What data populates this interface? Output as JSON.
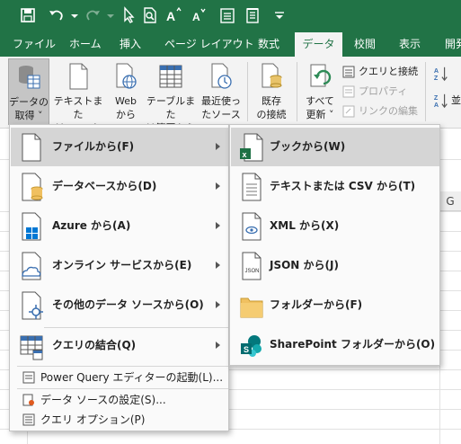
{
  "ribbon_tabs": {
    "file": "ファイル",
    "home": "ホーム",
    "insert": "挿入",
    "page_layout": "ページ レイアウト",
    "formulas": "数式",
    "data": "データ",
    "review": "校閲",
    "view": "表示",
    "developer": "開発"
  },
  "ribbon": {
    "get_data": "データの\n取得 ˅",
    "from_text_csv": "テキストまた\nは CSV から",
    "from_web": "Web\nから",
    "from_table_range": "テーブルまた\nは範囲から",
    "recent_sources": "最近使っ\nたソース",
    "existing_connections": "既存\nの接続",
    "refresh_all": "すべて\n更新 ˅",
    "queries_connections": "クエリと接続",
    "properties": "プロパティ",
    "edit_links": "リンクの編集",
    "sort_label": "並"
  },
  "sheet": {
    "column_g": "G"
  },
  "menu_get_data": {
    "from_file": "ファイルから(F)",
    "from_database": "データベースから(D)",
    "from_azure": "Azure から(A)",
    "from_online_services": "オンライン サービスから(E)",
    "from_other_sources": "その他のデータ ソースから(O)",
    "combine_queries": "クエリの結合(Q)",
    "launch_power_query": "Power Query エディターの起動(L)...",
    "data_source_settings": "データ ソースの設定(S)...",
    "query_options": "クエリ オプション(P)"
  },
  "menu_from_file": {
    "from_workbook": "ブックから(W)",
    "from_text_csv": "テキストまたは CSV から(T)",
    "from_xml": "XML から(X)",
    "from_json": "JSON から(J)",
    "from_folder": "フォルダーから(F)",
    "from_sharepoint_folder": "SharePoint フォルダーから(O)"
  },
  "colors": {
    "title_bar": "#217346",
    "ribbon": "#f3f3f3",
    "menu_background": "#fafafa",
    "menu_highlight": "#d5d5d5",
    "folder": "#f0c060",
    "excel_green": "#1e7145",
    "sharepoint": "#036c70",
    "azure_blue": "#0078d4"
  }
}
